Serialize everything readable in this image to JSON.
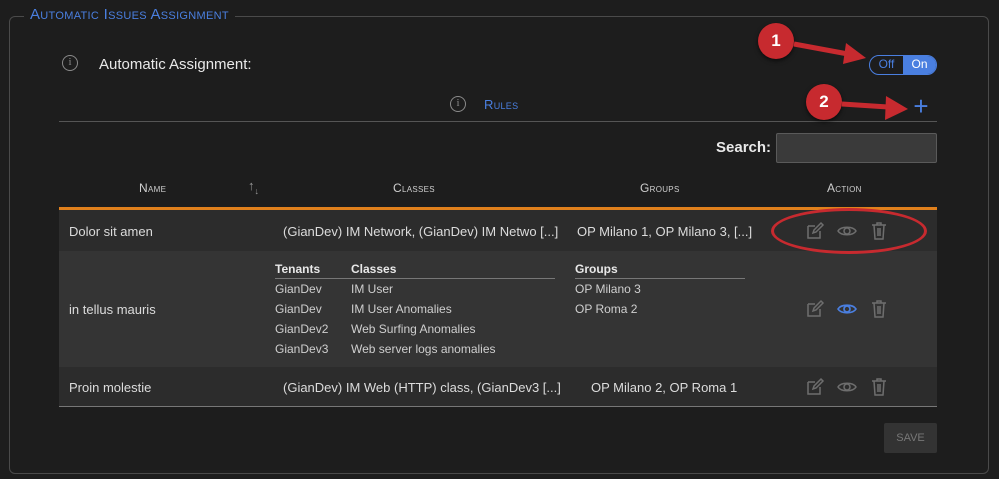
{
  "section": {
    "legend": "Automatic Issues Assignment"
  },
  "auto_assignment": {
    "label": "Automatic Assignment:",
    "toggle": {
      "off_label": "Off",
      "on_label": "On",
      "state": "On"
    }
  },
  "rules": {
    "title": "Rules",
    "add_icon": "plus-icon"
  },
  "search": {
    "label": "Search:",
    "value": ""
  },
  "table": {
    "headers": {
      "name": "Name",
      "classes": "Classes",
      "groups": "Groups",
      "action": "Action"
    },
    "rows": [
      {
        "name": "Dolor sit amen",
        "classes": "(GianDev) IM Network, (GianDev) IM Netwo [...]",
        "groups": "OP Milano 1, OP Milano 3, [...]"
      },
      {
        "name": "in tellus mauris",
        "detail": {
          "tenants_header": "Tenants",
          "classes_header": "Classes",
          "groups_header": "Groups",
          "tenants": [
            "GianDev",
            "GianDev",
            "GianDev2",
            "GianDev3"
          ],
          "classes": [
            "IM User",
            "IM User Anomalies",
            "Web Surfing Anomalies",
            "Web server logs anomalies"
          ],
          "groups": [
            "OP Milano 3",
            "OP Roma 2"
          ]
        }
      },
      {
        "name": "Proin molestie",
        "classes": "(GianDev) IM Web (HTTP) class, (GianDev3 [...]",
        "groups": "OP Milano 2, OP Roma 1"
      }
    ]
  },
  "save_label": "SAVE",
  "annotations": {
    "badge1": "1",
    "badge2": "2"
  },
  "colors": {
    "accent": "#4a7fe0",
    "highlight_bar": "#e0801c",
    "annotation_red": "#c72a2f"
  }
}
